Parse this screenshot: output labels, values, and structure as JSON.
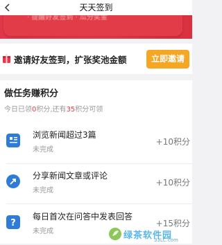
{
  "header": {
    "title": "天天签到",
    "back_icon": "back-arrow-icon"
  },
  "banner": {
    "text": "· 提醒好友签到 · 瓜分奖金"
  },
  "invite": {
    "icon": "gift-icon",
    "text": "邀请好友签到，扩张奖池金额",
    "button": "立即邀请"
  },
  "tasks": {
    "title": "做任务赚积分",
    "sub_prefix": "今日已领",
    "earned": "0",
    "sub_middle": "积分,还有",
    "remaining": "35",
    "sub_suffix": "积分可领",
    "items": [
      {
        "icon": "news-doc-icon",
        "name": "浏览新闻超过3篇",
        "status": "未完成",
        "points": "+10积分"
      },
      {
        "icon": "share-arrow-icon",
        "name": "分享新闻文章或评论",
        "status": "未完成",
        "points": "+10积分"
      },
      {
        "icon": "question-icon",
        "name": "每日首次在问答中发表回答",
        "status": "未完成",
        "points": "+15积分"
      }
    ]
  },
  "watermark": {
    "text": "绿茶软件园",
    "url": "33LC.com"
  },
  "colors": {
    "accent_red": "#e8374a",
    "button_orange": "#f5a623",
    "icon_blue": "#2f7bd8"
  }
}
